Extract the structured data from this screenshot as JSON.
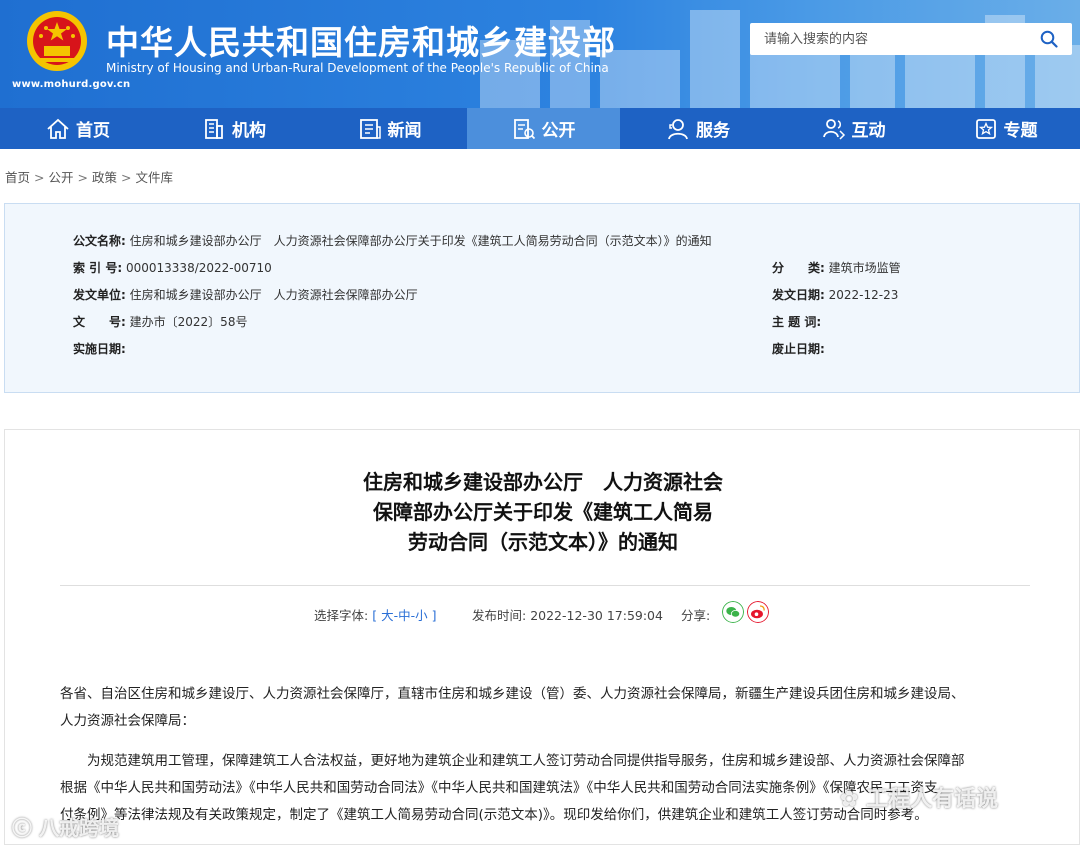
{
  "header": {
    "site_url": "www.mohurd.gov.cn",
    "title": "中华人民共和国住房和城乡建设部",
    "subtitle": "Ministry of Housing and Urban-Rural Development of the People's Republic of China",
    "search_placeholder": "请输入搜索的内容"
  },
  "nav": {
    "items": [
      {
        "label": "首页",
        "icon": "home-icon"
      },
      {
        "label": "机构",
        "icon": "building-icon"
      },
      {
        "label": "新闻",
        "icon": "news-icon"
      },
      {
        "label": "公开",
        "icon": "open-doc-icon",
        "active": true
      },
      {
        "label": "服务",
        "icon": "service-icon"
      },
      {
        "label": "互动",
        "icon": "interaction-icon"
      },
      {
        "label": "专题",
        "icon": "topic-star-icon"
      }
    ]
  },
  "breadcrumb": [
    "首页",
    "公开",
    "政策",
    "文件库"
  ],
  "info": {
    "doc_name_label": "公文名称:",
    "doc_name": "住房和城乡建设部办公厅　人力资源社会保障部办公厅关于印发《建筑工人简易劳动合同（示范文本）》的通知",
    "index_label": "索 引 号:",
    "index_no": "000013338/2022-00710",
    "category_label": "分　　类:",
    "category": "建筑市场监管",
    "issuer_label": "发文单位:",
    "issuer": "住房和城乡建设部办公厅　人力资源社会保障部办公厅",
    "issue_date_label": "发文日期:",
    "issue_date": "2022-12-23",
    "doc_no_label": "文　　号:",
    "doc_no": "建办市〔2022〕58号",
    "keywords_label": "主 题 词:",
    "keywords": "",
    "effective_label": "实施日期:",
    "effective": "",
    "expiry_label": "废止日期:",
    "expiry": ""
  },
  "article": {
    "title_line1": "住房和城乡建设部办公厅　人力资源社会",
    "title_line2": "保障部办公厅关于印发《建筑工人简易",
    "title_line3": "劳动合同（示范文本）》的通知",
    "font_label": "选择字体:",
    "font_open": "[",
    "font_large": "大",
    "font_medium": "中",
    "font_small": "小",
    "font_close": "]",
    "font_sep": "-",
    "publish_label": "发布时间:",
    "publish_time": "2022-12-30 17:59:04",
    "share_label": "分享:",
    "para1_line1": "各省、自治区住房和城乡建设厅、人力资源社会保障厅，直辖市住房和城乡建设（管）委、人力资源社会保障局，新疆生产建设兵团住房和城乡建设局、",
    "para1_line2": "人力资源社会保障局：",
    "para2_line1": "　　为规范建筑用工管理，保障建筑工人合法权益，更好地为建筑企业和建筑工人签订劳动合同提供指导服务，住房和城乡建设部、人力资源社会保障部",
    "para2_line2": "根据《中华人民共和国劳动法》《中华人民共和国劳动合同法》《中华人民共和国建筑法》《中华人民共和国劳动合同法实施条例》《保障农民工工资支",
    "para2_line3": "付条例》等法律法规及有关政策规定，制定了《建筑工人简易劳动合同(示范文本)》。现印发给你们，供建筑企业和建筑工人签订劳动合同时参考。"
  },
  "watermarks": {
    "left": "八戒跨境",
    "right": "工程人有话说"
  },
  "colors": {
    "header_blue": "#1f6fd1",
    "nav_blue": "#1e62c4",
    "nav_active": "#4c8fdc",
    "info_bg": "#f1f7fd",
    "link_blue": "#2a6fd6",
    "wechat_green": "#3bb34a",
    "weibo_red": "#e6162d"
  }
}
